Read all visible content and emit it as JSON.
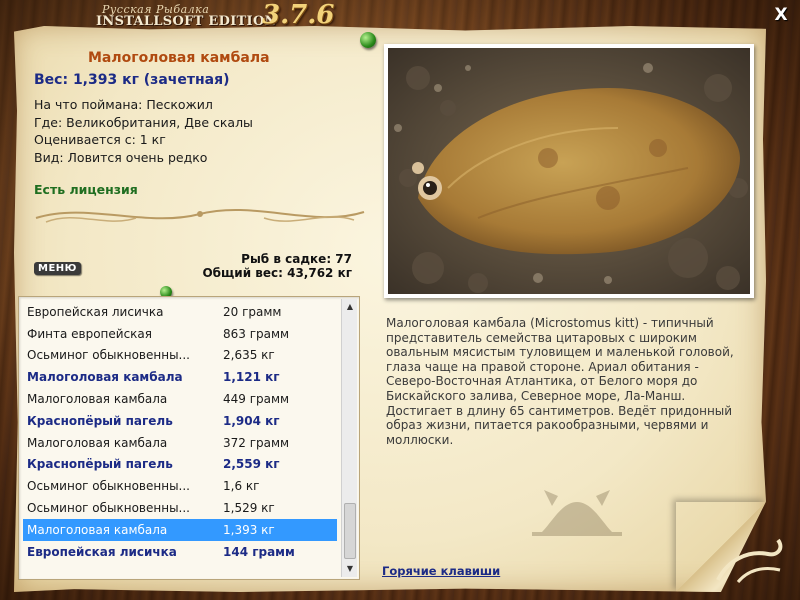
{
  "app": {
    "brand_top": "Русская Рыбалка",
    "brand_main": "INSTALLSOFT EDITION",
    "version": "3.7.6",
    "close_label": "X"
  },
  "fish": {
    "title": "Малоголовая камбала",
    "weight": "Вес: 1,393 кг (зачетная)",
    "caught_on": "На что поймана: Пескожил",
    "location": "Где: Великобритания, Две скалы",
    "valued_from": "Оценивается с: 1 кг",
    "kind": "Вид: Ловится очень редко",
    "license": "Есть лицензия"
  },
  "cage": {
    "count": "Рыб в садке: 77",
    "total": "Общий вес: 43,762 кг"
  },
  "menu_label": "МЕНЮ",
  "catch_list": [
    {
      "name": "Европейская лисичка",
      "weight": "20 грамм",
      "bold": false,
      "selected": false
    },
    {
      "name": "Финта европейская",
      "weight": "863 грамм",
      "bold": false,
      "selected": false
    },
    {
      "name": "Осьминог обыкновенны...",
      "weight": "2,635 кг",
      "bold": false,
      "selected": false
    },
    {
      "name": "Малоголовая камбала",
      "weight": "1,121 кг",
      "bold": true,
      "selected": false
    },
    {
      "name": "Малоголовая камбала",
      "weight": "449 грамм",
      "bold": false,
      "selected": false
    },
    {
      "name": "Краснопёрый пагель",
      "weight": "1,904 кг",
      "bold": true,
      "selected": false
    },
    {
      "name": "Малоголовая камбала",
      "weight": "372 грамм",
      "bold": false,
      "selected": false
    },
    {
      "name": "Краснопёрый пагель",
      "weight": "2,559 кг",
      "bold": true,
      "selected": false
    },
    {
      "name": "Осьминог обыкновенны...",
      "weight": "1,6 кг",
      "bold": false,
      "selected": false
    },
    {
      "name": "Осьминог обыкновенны...",
      "weight": "1,529 кг",
      "bold": false,
      "selected": false
    },
    {
      "name": "Малоголовая камбала",
      "weight": "1,393 кг",
      "bold": false,
      "selected": true
    },
    {
      "name": "Европейская лисичка",
      "weight": "144 грамм",
      "bold": true,
      "selected": false
    }
  ],
  "description": "Малоголовая камбала (Microstomus kitt) - типичный представитель семейства цитаровых с широким овальным мясистым туловищем и маленькой головой, глаза чаще на правой стороне. Ариал обитания - Северо-Восточная Атлантика, от Белого моря до Бискайского залива, Северное море, Ла-Манш. Достигает в длину 65 сантиметров. Ведёт придонный образ жизни, питается ракообразными, червями и моллюски.",
  "hotkeys_label": "Горячие клавиши",
  "icons": {
    "close": "close-icon",
    "scroll_up": "chevron-up-icon",
    "scroll_down": "chevron-down-icon",
    "pin": "pushpin-icon",
    "stamp": "crab-stamp-icon"
  },
  "colors": {
    "title": "#b04a10",
    "weight": "#1c2b86",
    "license": "#1f6e20",
    "selection": "#3399ff",
    "link": "#1c2b86"
  }
}
